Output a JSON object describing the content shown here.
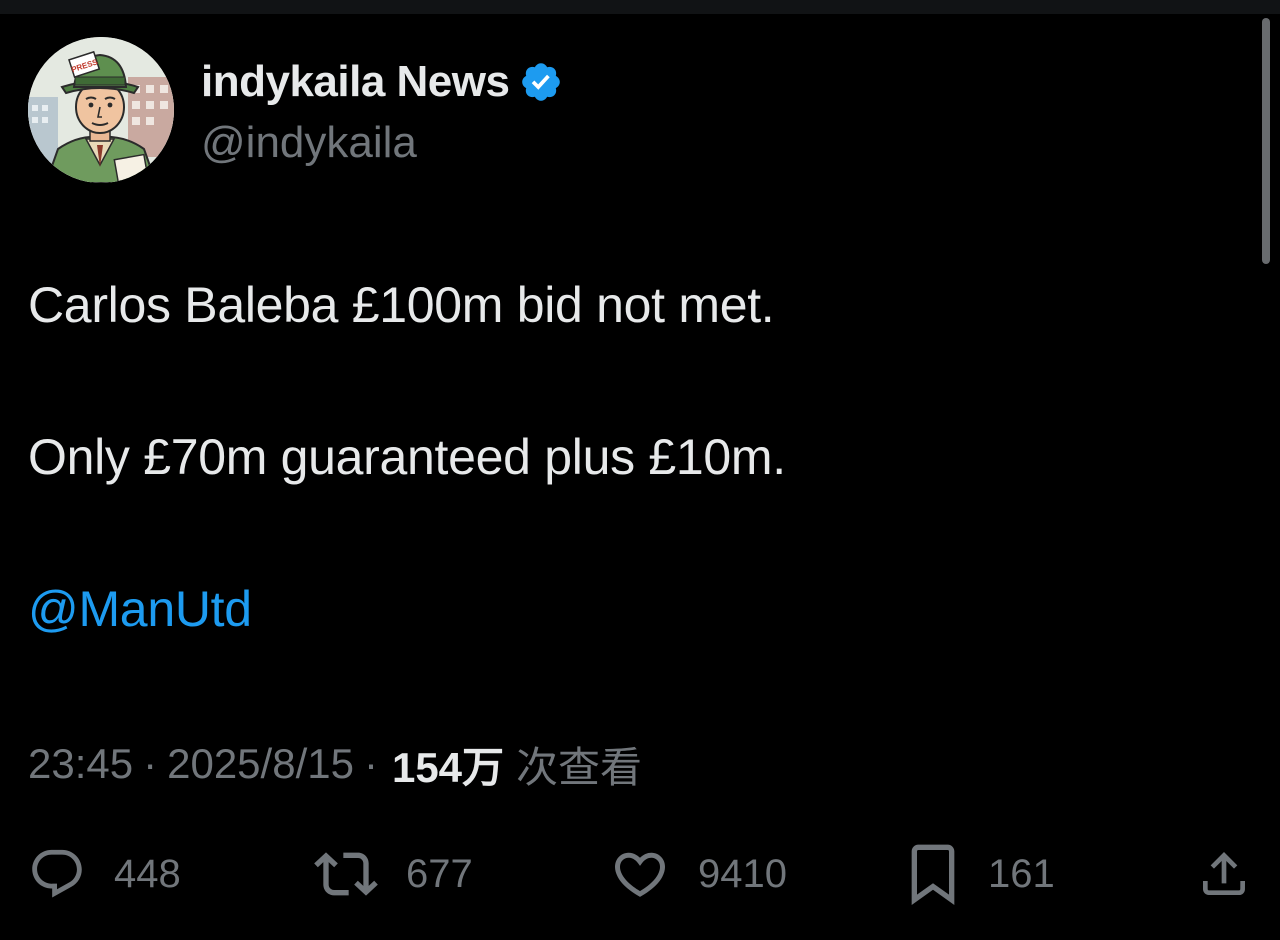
{
  "author": {
    "display_name": "indykaila News",
    "handle": "@indykaila",
    "verified": true,
    "avatar_icon": "press-reporter-cartoon-avatar",
    "avatar_hat_text": "PRESS"
  },
  "tweet": {
    "line_1": "Carlos Baleba £100m bid not met.",
    "line_2": "Only £70m guaranteed plus £10m.",
    "mention": "@ManUtd"
  },
  "meta": {
    "time": "23:45",
    "separator": "·",
    "date": "2025/8/15",
    "views_count": "154万",
    "views_label": "次查看"
  },
  "actions": {
    "replies": "448",
    "reposts": "677",
    "likes": "9410",
    "bookmarks": "161",
    "icons": [
      "reply-icon",
      "repost-icon",
      "like-icon",
      "bookmark-icon",
      "share-icon"
    ]
  },
  "colors": {
    "background": "#000000",
    "primary_text": "#e7e9ea",
    "secondary_text": "#71767b",
    "accent_blue": "#1d9bf0"
  }
}
